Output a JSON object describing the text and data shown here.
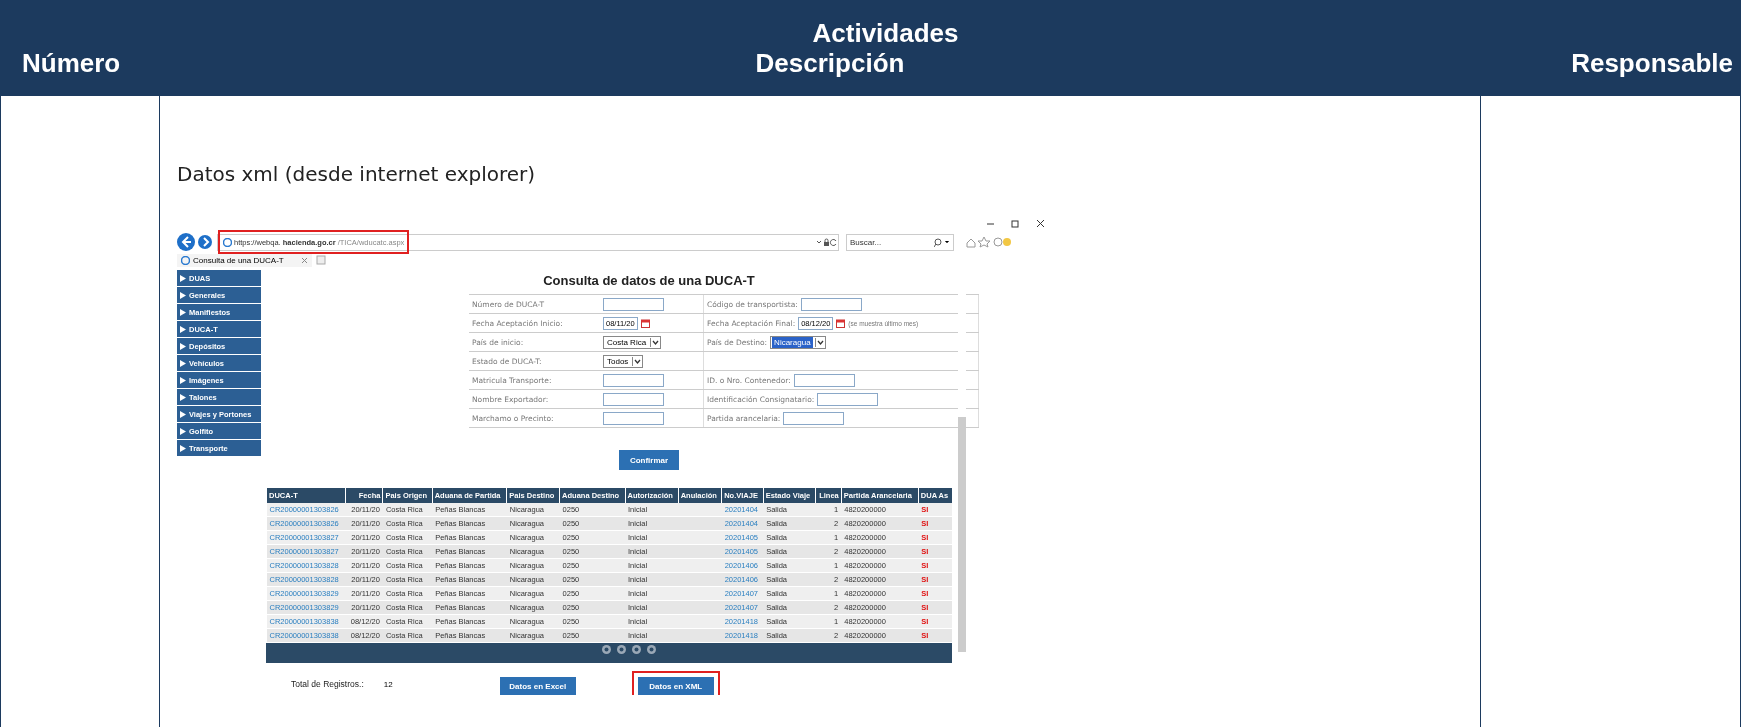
{
  "header": {
    "group_title": "Actividades",
    "columns": [
      "Número",
      "Descripción",
      "Responsable"
    ]
  },
  "description": "Datos xml (desde internet explorer)",
  "browser": {
    "url_host": "https://webqa.",
    "url_domain": "hacienda.go.cr",
    "url_path": "/TICA/wducatc.aspx",
    "url_highlighted": true,
    "search_placeholder": "Buscar...",
    "tab_title": "Consulta de una DUCA-T"
  },
  "sidebar": {
    "items": [
      "DUAS",
      "Generales",
      "Manifiestos",
      "DUCA-T",
      "Depósitos",
      "Vehículos",
      "Imágenes",
      "Talones",
      "Viajes y Portones",
      "Golfito",
      "Transporte"
    ]
  },
  "page_title": "Consulta de datos de una DUCA-T",
  "form": {
    "rows": [
      {
        "left": {
          "label": "Número de DUCA-T",
          "kind": "text"
        },
        "right": {
          "label": "Código de transportista:",
          "kind": "text"
        }
      },
      {
        "left": {
          "label": "Fecha Aceptación Inicio:",
          "kind": "date",
          "value": "08/11/20"
        },
        "right": {
          "label": "Fecha Aceptación Final:",
          "kind": "date",
          "value": "08/12/20",
          "note": "(se muestra último mes)"
        }
      },
      {
        "left": {
          "label": "País de inicio:",
          "kind": "select",
          "value": "Costa Rica",
          "highlighted": false
        },
        "right": {
          "label": "País de Destino:",
          "kind": "select",
          "value": "Nicaragua",
          "highlighted": true
        }
      },
      {
        "left": {
          "label": "Estado de DUCA-T:",
          "kind": "select",
          "value": "Todos",
          "highlighted": false
        }
      },
      {
        "left": {
          "label": "Matricula Transporte:",
          "kind": "text"
        },
        "right": {
          "label": "ID. o Nro. Contenedor:",
          "kind": "text"
        }
      },
      {
        "left": {
          "label": "Nombre Exportador:",
          "kind": "text"
        },
        "right": {
          "label": "Identificación Consignatario:",
          "kind": "text"
        }
      },
      {
        "left": {
          "label": "Marchamo o Precinto:",
          "kind": "text"
        },
        "right": {
          "label": "Partida arancelaria:",
          "kind": "text"
        }
      }
    ]
  },
  "confirm_button": "Confirmar",
  "table": {
    "columns": [
      {
        "label": "DUCA-T",
        "kind": "link"
      },
      {
        "label": "Fecha",
        "kind": "number"
      },
      {
        "label": "Pais Origen",
        "kind": "plain"
      },
      {
        "label": "Aduana de Partida",
        "kind": "plain"
      },
      {
        "label": "Pais Destino",
        "kind": "plain"
      },
      {
        "label": "Aduana Destino",
        "kind": "plain"
      },
      {
        "label": "Autorización",
        "kind": "plain"
      },
      {
        "label": "Anulación",
        "kind": "plain"
      },
      {
        "label": "No.VIAJE",
        "kind": "link"
      },
      {
        "label": "Estado Viaje",
        "kind": "plain"
      },
      {
        "label": "Linea",
        "kind": "number"
      },
      {
        "label": "Partida Arancelaria",
        "kind": "plain"
      },
      {
        "label": "DUA As",
        "kind": "flag"
      }
    ],
    "rows": [
      [
        "CR20000001303826",
        "20/11/20",
        "Costa Rica",
        "Peñas Blancas",
        "Nicaragua",
        "0250",
        "Inicial",
        null,
        "20201404",
        "Salida",
        "1",
        "4820200000",
        "SI"
      ],
      [
        "CR20000001303826",
        "20/11/20",
        "Costa Rica",
        "Peñas Blancas",
        "Nicaragua",
        "0250",
        "Inicial",
        null,
        "20201404",
        "Salida",
        "2",
        "4820200000",
        "SI"
      ],
      [
        "CR20000001303827",
        "20/11/20",
        "Costa Rica",
        "Peñas Blancas",
        "Nicaragua",
        "0250",
        "Inicial",
        null,
        "20201405",
        "Salida",
        "1",
        "4820200000",
        "SI"
      ],
      [
        "CR20000001303827",
        "20/11/20",
        "Costa Rica",
        "Peñas Blancas",
        "Nicaragua",
        "0250",
        "Inicial",
        null,
        "20201405",
        "Salida",
        "2",
        "4820200000",
        "SI"
      ],
      [
        "CR20000001303828",
        "20/11/20",
        "Costa Rica",
        "Peñas Blancas",
        "Nicaragua",
        "0250",
        "Inicial",
        null,
        "20201406",
        "Salida",
        "1",
        "4820200000",
        "SI"
      ],
      [
        "CR20000001303828",
        "20/11/20",
        "Costa Rica",
        "Peñas Blancas",
        "Nicaragua",
        "0250",
        "Inicial",
        null,
        "20201406",
        "Salida",
        "2",
        "4820200000",
        "SI"
      ],
      [
        "CR20000001303829",
        "20/11/20",
        "Costa Rica",
        "Peñas Blancas",
        "Nicaragua",
        "0250",
        "Inicial",
        null,
        "20201407",
        "Salida",
        "1",
        "4820200000",
        "SI"
      ],
      [
        "CR20000001303829",
        "20/11/20",
        "Costa Rica",
        "Peñas Blancas",
        "Nicaragua",
        "0250",
        "Inicial",
        null,
        "20201407",
        "Salida",
        "2",
        "4820200000",
        "SI"
      ],
      [
        "CR20000001303838",
        "08/12/20",
        "Costa Rica",
        "Peñas Blancas",
        "Nicaragua",
        "0250",
        "Inicial",
        null,
        "20201418",
        "Salida",
        "1",
        "4820200000",
        "SI"
      ],
      [
        "CR20000001303838",
        "08/12/20",
        "Costa Rica",
        "Peñas Blancas",
        "Nicaragua",
        "0250",
        "Inicial",
        null,
        "20201418",
        "Salida",
        "2",
        "4820200000",
        "SI"
      ]
    ]
  },
  "footer": {
    "total_label": "Total de Registros.:",
    "total_value": "12",
    "buttons": [
      {
        "label": "Datos en Excel",
        "highlighted": false
      },
      {
        "label": "Datos en XML",
        "highlighted": true
      }
    ]
  }
}
